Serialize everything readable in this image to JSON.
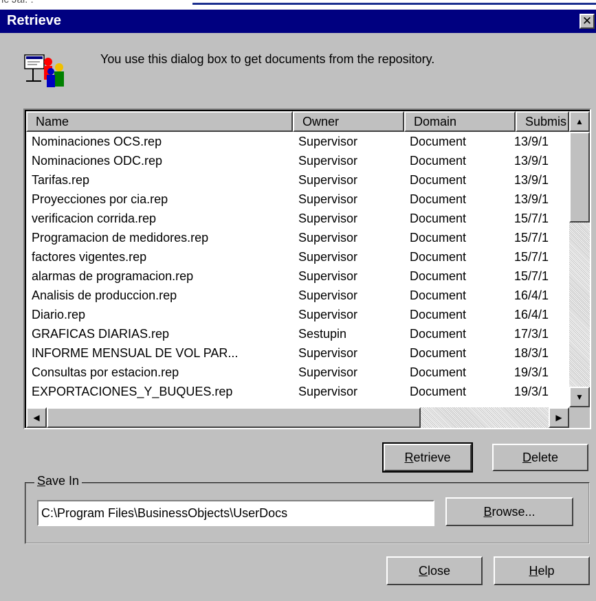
{
  "window": {
    "title": "Retrieve",
    "close_glyph": "✕"
  },
  "background": {
    "partial_text": "ic Jai. ."
  },
  "intro": {
    "icon": "users-documents-icon",
    "text": "You use this dialog box to get documents from the repository."
  },
  "list": {
    "columns": [
      "Name",
      "Owner",
      "Domain",
      "Submis"
    ],
    "rows": [
      [
        "Nominaciones OCS.rep",
        "Supervisor",
        "Document",
        "13/9/1"
      ],
      [
        "Nominaciones ODC.rep",
        "Supervisor",
        "Document",
        "13/9/1"
      ],
      [
        "Tarifas.rep",
        "Supervisor",
        "Document",
        "13/9/1"
      ],
      [
        "Proyecciones por cia.rep",
        "Supervisor",
        "Document",
        "13/9/1"
      ],
      [
        "verificacion corrida.rep",
        "Supervisor",
        "Document",
        "15/7/1"
      ],
      [
        "Programacion de medidores.rep",
        "Supervisor",
        "Document",
        "15/7/1"
      ],
      [
        "factores vigentes.rep",
        "Supervisor",
        "Document",
        "15/7/1"
      ],
      [
        "alarmas de programacion.rep",
        "Supervisor",
        "Document",
        "15/7/1"
      ],
      [
        "Analisis de produccion.rep",
        "Supervisor",
        "Document",
        "16/4/1"
      ],
      [
        "Diario.rep",
        "Supervisor",
        "Document",
        "16/4/1"
      ],
      [
        "GRAFICAS DIARIAS.rep",
        "Sestupin",
        "Document",
        "17/3/1"
      ],
      [
        "INFORME MENSUAL DE VOL PAR...",
        "Supervisor",
        "Document",
        "18/3/1"
      ],
      [
        "Consultas por estacion.rep",
        "Supervisor",
        "Document",
        "19/3/1"
      ],
      [
        "EXPORTACIONES_Y_BUQUES.rep",
        "Supervisor",
        "Document",
        "19/3/1"
      ]
    ]
  },
  "buttons": {
    "retrieve": {
      "mnemonic": "R",
      "rest": "etrieve"
    },
    "delete": {
      "mnemonic": "D",
      "rest": "elete"
    },
    "browse": {
      "mnemonic": "B",
      "rest": "rowse..."
    },
    "close": {
      "mnemonic": "C",
      "rest": "lose"
    },
    "help": {
      "mnemonic": "H",
      "rest": "elp"
    }
  },
  "save_in": {
    "label_mnemonic": "S",
    "label_rest": "ave In",
    "path": "C:\\Program Files\\BusinessObjects\\UserDocs"
  },
  "colors": {
    "titlebar": "#000080",
    "face": "#c0c0c0"
  }
}
